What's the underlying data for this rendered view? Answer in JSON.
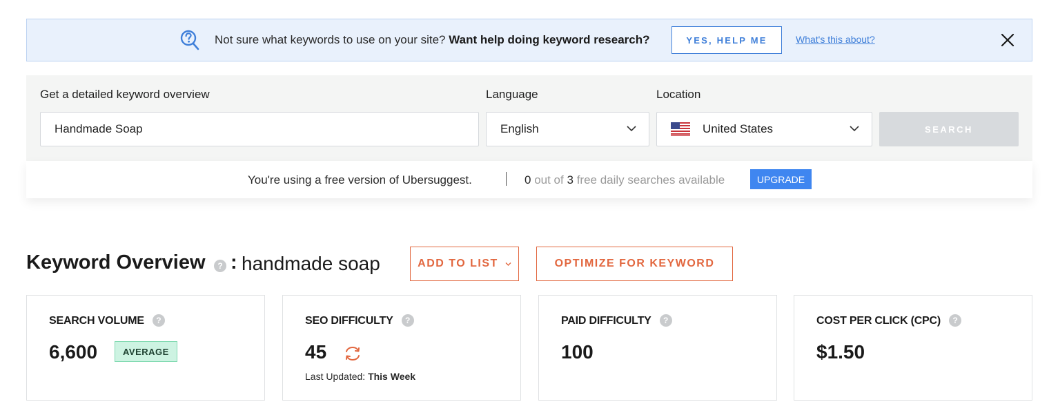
{
  "banner": {
    "message": "Not sure what keywords to use on your site?",
    "message_bold": "Want help doing keyword research?",
    "yes_button": "YES, HELP ME",
    "about_link": "What's this about?"
  },
  "search": {
    "overview_label": "Get a detailed keyword overview",
    "keyword_value": "Handmade Soap",
    "language_label": "Language",
    "language_value": "English",
    "location_label": "Location",
    "location_value": "United States",
    "search_button": "SEARCH"
  },
  "usage": {
    "free_text": "You're using a free version of Ubersuggest.",
    "used": "0",
    "out_of_text": "out of",
    "total": "3",
    "tail_text": "free daily searches available",
    "upgrade_button": "UPGRADE"
  },
  "overview": {
    "title": "Keyword Overview",
    "help": "?",
    "colon": ":",
    "keyword": "handmade soap",
    "add_to_list": "ADD TO LIST",
    "optimize": "OPTIMIZE FOR KEYWORD"
  },
  "metrics": {
    "search_volume": {
      "title": "SEARCH VOLUME",
      "value": "6,600",
      "badge": "AVERAGE"
    },
    "seo_difficulty": {
      "title": "SEO DIFFICULTY",
      "value": "45",
      "updated_label": "Last Updated:",
      "updated_value": "This Week"
    },
    "paid_difficulty": {
      "title": "PAID DIFFICULTY",
      "value": "100"
    },
    "cpc": {
      "title": "COST PER CLICK (CPC)",
      "value": "$1.50"
    }
  },
  "colors": {
    "accent_orange": "#e2673f",
    "link_blue": "#3f7fd9",
    "upgrade_blue": "#3f86f0",
    "badge_green": "#cdf3e2"
  }
}
